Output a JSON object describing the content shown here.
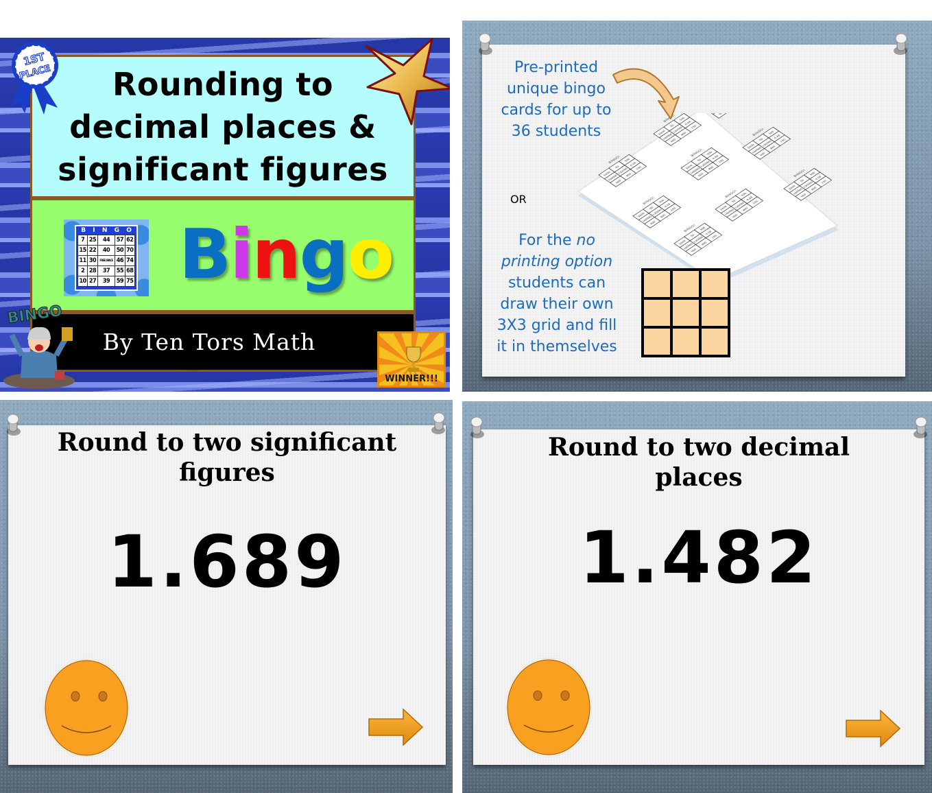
{
  "panels": {
    "cover": {
      "title_lines": [
        "Rounding to",
        "decimal places &",
        "significant figures"
      ],
      "bingo_word": [
        {
          "char": "B",
          "color": "#0a6fc0"
        },
        {
          "char": "i",
          "color": "#cc3ae8"
        },
        {
          "char": "n",
          "color": "#ee1111"
        },
        {
          "char": "g",
          "color": "#0a6fc0"
        },
        {
          "char": "o",
          "color": "#ffee00"
        },
        {
          "char": "!",
          "color": "#111111"
        }
      ],
      "bingo_card": {
        "header": [
          "B",
          "I",
          "N",
          "G",
          "O"
        ],
        "rows": [
          [
            "7",
            "25",
            "44",
            "57",
            "62"
          ],
          [
            "15",
            "22",
            "40",
            "50",
            "70"
          ],
          [
            "11",
            "30",
            "FREE SPACE",
            "46",
            "74"
          ],
          [
            "2",
            "28",
            "37",
            "55",
            "68"
          ],
          [
            "10",
            "27",
            "39",
            "59",
            "75"
          ]
        ]
      },
      "ribbon_text": [
        "1ST",
        "PLACE"
      ],
      "lady_sign": "BINGO",
      "winner_label": "WINNER!!!",
      "byline": "By Ten Tors Math"
    },
    "info": {
      "printed_text": [
        "Pre-printed",
        "unique bingo",
        "cards for up to",
        "36 students"
      ],
      "or_text": "OR",
      "no_print_lines": [
        {
          "parts": [
            {
              "t": "For the ",
              "i": false
            },
            {
              "t": "no",
              "i": true
            }
          ]
        },
        {
          "parts": [
            {
              "t": "printing option",
              "i": true
            }
          ]
        },
        {
          "parts": [
            {
              "t": "students can",
              "i": false
            }
          ]
        },
        {
          "parts": [
            {
              "t": "draw their own",
              "i": false
            }
          ]
        },
        {
          "parts": [
            {
              "t": "3X3 grid and fill",
              "i": false
            }
          ]
        },
        {
          "parts": [
            {
              "t": "it in themselves",
              "i": false
            }
          ]
        }
      ],
      "sample_card": {
        "title": "BINGO!",
        "subtitle": "Multiplying & dividing by multiples of ten",
        "cells": [
          "5000",
          "50",
          "500",
          "100000",
          "120000",
          "0.28",
          "600",
          "800",
          "150"
        ]
      }
    },
    "question1": {
      "title_lines": [
        "Round to two significant",
        "figures"
      ],
      "number": "1.689"
    },
    "question2": {
      "title_lines": [
        "Round to two decimal",
        "places"
      ],
      "number": "1.482"
    }
  },
  "colors": {
    "cover_title_bg": "#b4fdfc",
    "cover_green_bg": "#97fd6c",
    "cover_frame": "#8a5a1e",
    "info_text": "#1c6bbd",
    "grid_fill": "#fbd6a0",
    "smiley_fill": "#f9a020",
    "arrow_fill": "#f7a026"
  }
}
